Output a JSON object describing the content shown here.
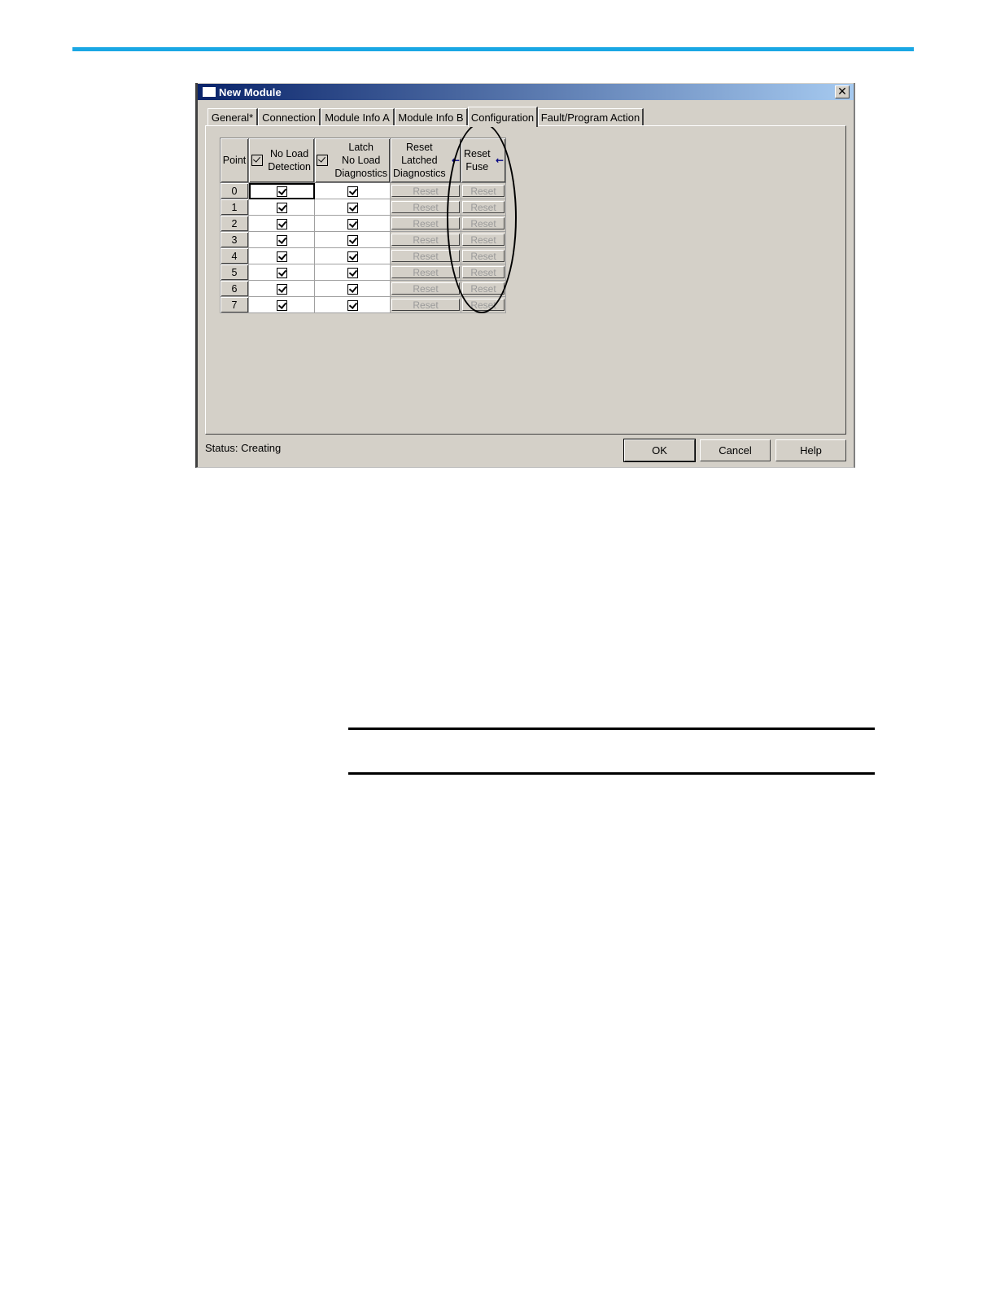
{
  "colors": {
    "accent_rule": "#1aa7e4",
    "titlebar_start": "#0a246a",
    "titlebar_end": "#a6caf0"
  },
  "window": {
    "title": "New Module",
    "close_glyph": "✕"
  },
  "tabs": [
    {
      "label": "General*",
      "active": false
    },
    {
      "label": "Connection",
      "active": false
    },
    {
      "label": "Module Info A",
      "active": false
    },
    {
      "label": "Module Info B",
      "active": false
    },
    {
      "label": "Configuration",
      "active": true
    },
    {
      "label": "Fault/Program Action",
      "active": false
    }
  ],
  "grid": {
    "headers": {
      "point": "Point",
      "no_load_line1": "No Load",
      "no_load_line2": "Detection",
      "latch_line1": "Latch",
      "latch_line2": "No Load",
      "latch_line3": "Diagnostics",
      "reset_latched_line1": "Reset",
      "reset_latched_line2": "Latched",
      "reset_latched_line3": "Diagnostics",
      "reset_fuse_line1": "Reset",
      "reset_fuse_line2": "Fuse",
      "arrow_glyph": "←"
    },
    "rows": [
      {
        "point": "0",
        "no_load": true,
        "latch": true,
        "reset_latched": "Reset",
        "reset_fuse": "Reset"
      },
      {
        "point": "1",
        "no_load": true,
        "latch": true,
        "reset_latched": "Reset",
        "reset_fuse": "Reset"
      },
      {
        "point": "2",
        "no_load": true,
        "latch": true,
        "reset_latched": "Reset",
        "reset_fuse": "Reset"
      },
      {
        "point": "3",
        "no_load": true,
        "latch": true,
        "reset_latched": "Reset",
        "reset_fuse": "Reset"
      },
      {
        "point": "4",
        "no_load": true,
        "latch": true,
        "reset_latched": "Reset",
        "reset_fuse": "Reset"
      },
      {
        "point": "5",
        "no_load": true,
        "latch": true,
        "reset_latched": "Reset",
        "reset_fuse": "Reset"
      },
      {
        "point": "6",
        "no_load": true,
        "latch": true,
        "reset_latched": "Reset",
        "reset_fuse": "Reset"
      },
      {
        "point": "7",
        "no_load": true,
        "latch": true,
        "reset_latched": "Reset",
        "reset_fuse": "Reset"
      }
    ]
  },
  "footer": {
    "status": "Status:  Creating",
    "ok_label": "OK",
    "cancel_label": "Cancel",
    "help_label": "Help"
  }
}
